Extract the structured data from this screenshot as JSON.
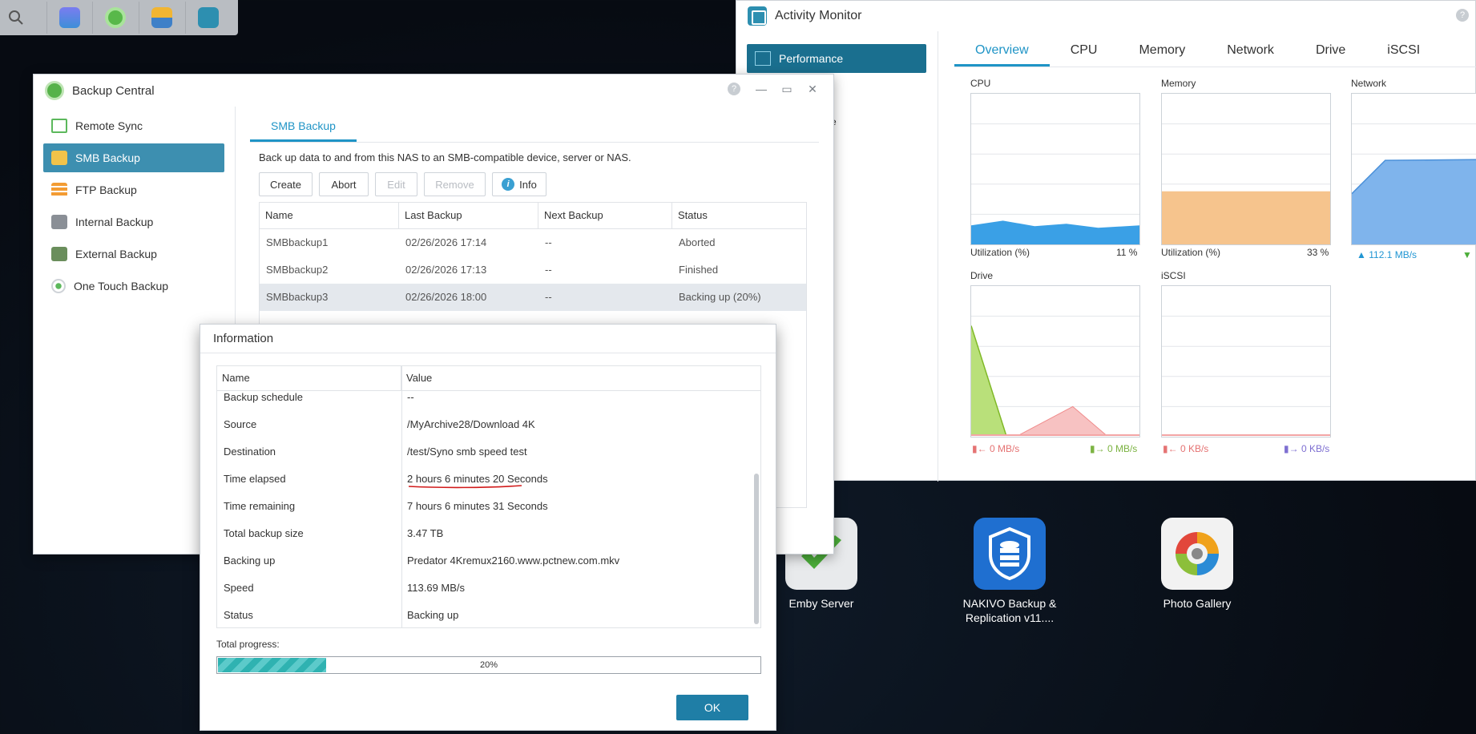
{
  "taskbar": {
    "icons": [
      "search-icon",
      "storage-app-icon",
      "backup-central-icon",
      "app-icon-yellow",
      "activity-monitor-icon"
    ]
  },
  "desktop": {
    "apps": [
      {
        "label": "Emby Server"
      },
      {
        "label": "NAKIVO Backup & Replication v11...."
      },
      {
        "label": "Photo Gallery"
      }
    ]
  },
  "activity_monitor": {
    "title": "Activity Monitor",
    "sidebar_item": "Performance",
    "sidebar_partial": "e",
    "tabs": [
      "Overview",
      "CPU",
      "Memory",
      "Network",
      "Drive",
      "iSCSI"
    ],
    "active_tab": "Overview",
    "panels": {
      "cpu": {
        "label": "CPU",
        "stat_label": "Utilization (%)",
        "stat_value": "11 %"
      },
      "memory": {
        "label": "Memory",
        "stat_label": "Utilization (%)",
        "stat_value": "33 %"
      },
      "network": {
        "label": "Network",
        "upload": "112.1 MB/s"
      },
      "drive": {
        "label": "Drive",
        "read": "0 MB/s",
        "write": "0 MB/s"
      },
      "iscsi": {
        "label": "iSCSI",
        "read": "0 KB/s",
        "write": "0 KB/s"
      }
    },
    "colors": {
      "cpu": "#3aa0e6",
      "memory": "#f6c48d",
      "network": "#7fb4ec",
      "drive_green": "#9ccc3c",
      "drive_red": "#f3a4a4"
    }
  },
  "backup_central": {
    "title": "Backup Central",
    "sidebar": [
      "Remote Sync",
      "SMB Backup",
      "FTP Backup",
      "Internal Backup",
      "External Backup",
      "One Touch Backup"
    ],
    "active_item": "SMB Backup",
    "tab": "SMB Backup",
    "description": "Back up data to and from this NAS to an SMB-compatible device, server or NAS.",
    "buttons": {
      "create": "Create",
      "abort": "Abort",
      "edit": "Edit",
      "remove": "Remove",
      "info": "Info"
    },
    "table": {
      "columns": [
        "Name",
        "Last Backup",
        "Next Backup",
        "Status"
      ],
      "rows": [
        {
          "name": "SMBbackup1",
          "last": "02/26/2026 17:14",
          "next": "--",
          "status": "Aborted"
        },
        {
          "name": "SMBbackup2",
          "last": "02/26/2026 17:13",
          "next": "--",
          "status": "Finished"
        },
        {
          "name": "SMBbackup3",
          "last": "02/26/2026 18:00",
          "next": "--",
          "status": "Backing up (20%)"
        }
      ]
    }
  },
  "info_dialog": {
    "title": "Information",
    "columns": [
      "Name",
      "Value"
    ],
    "rows": [
      {
        "name": "Backup schedule",
        "value": "--"
      },
      {
        "name": "Source",
        "value": "/MyArchive28/Download 4K"
      },
      {
        "name": "Destination",
        "value": "/test/Syno smb speed test"
      },
      {
        "name": "Time elapsed",
        "value": "2 hours 6 minutes 20 Seconds"
      },
      {
        "name": "Time remaining",
        "value": "7 hours 6 minutes 31 Seconds"
      },
      {
        "name": "Total backup size",
        "value": "3.47 TB"
      },
      {
        "name": "Backing up",
        "value": "Predator 4Kremux2160.www.pctnew.com.mkv"
      },
      {
        "name": "Speed",
        "value": "113.69 MB/s"
      },
      {
        "name": "Status",
        "value": "Backing up"
      }
    ],
    "progress_label": "Total progress:",
    "progress_value": 0.2,
    "progress_text": "20%",
    "ok_label": "OK"
  }
}
